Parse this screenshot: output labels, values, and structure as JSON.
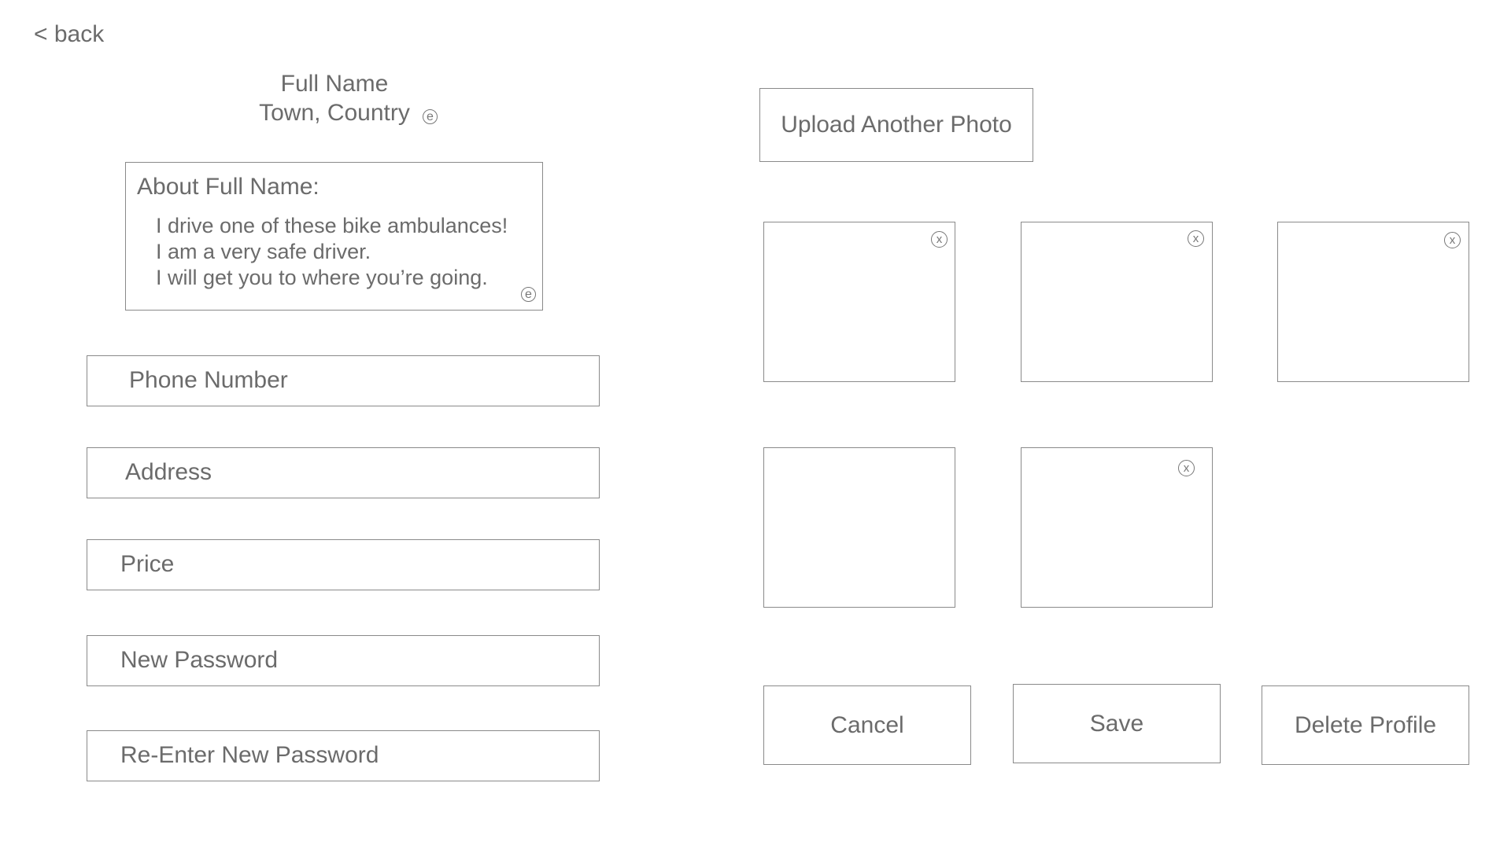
{
  "nav": {
    "back_label": "< back"
  },
  "profile": {
    "name": "Full Name",
    "location": "Town, Country",
    "edit_glyph": "e"
  },
  "about": {
    "title": "About Full Name:",
    "lines": [
      "I drive one of these bike ambulances!",
      "I am a very safe driver.",
      "I will get you to where you’re going."
    ]
  },
  "fields": {
    "phone_placeholder": "Phone Number",
    "address_placeholder": "Address",
    "price_placeholder": "Price",
    "new_password_placeholder": "New Password",
    "reenter_password_placeholder": "Re-Enter New Password"
  },
  "photos": {
    "upload_label": "Upload Another Photo",
    "remove_glyph": "x"
  },
  "actions": {
    "cancel_label": "Cancel",
    "save_label": "Save",
    "delete_label": "Delete Profile"
  },
  "icons": {
    "edit": "edit-icon",
    "remove": "close-icon"
  },
  "colors": {
    "text": "#6b6b6b",
    "border": "#8a8a8a",
    "background": "#ffffff"
  }
}
